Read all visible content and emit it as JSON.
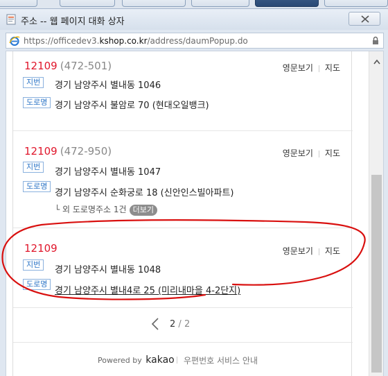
{
  "window": {
    "title": "주소 -- 웹 페이지 대화 상자",
    "url_prefix": "https://officedev3.",
    "url_domain": "kshop.co.kr",
    "url_path": "/address/daumPopup.do"
  },
  "results": [
    {
      "zipcode": "12109",
      "old_zipcode": "(472-501)",
      "english_link": "영문보기",
      "map_link": "지도",
      "jibun_badge": "지번",
      "jibun_address": "경기 남양주시 별내동 1046",
      "road_badge": "도로명",
      "road_address": "경기 남양주시 불암로 70 (현대오일뱅크)"
    },
    {
      "zipcode": "12109",
      "old_zipcode": "(472-950)",
      "english_link": "영문보기",
      "map_link": "지도",
      "jibun_badge": "지번",
      "jibun_address": "경기 남양주시 별내동 1047",
      "road_badge": "도로명",
      "road_address": "경기 남양주시 순화궁로 18 (신안인스빌아파트)",
      "more_text": "└ 외 도로명주소 1건",
      "more_button": "더보기"
    },
    {
      "zipcode": "12109",
      "english_link": "영문보기",
      "map_link": "지도",
      "jibun_badge": "지번",
      "jibun_address": "경기 남양주시 별내동 1048",
      "road_badge": "도로명",
      "road_address": "경기 남양주시 별내4로 25 (미리내마을 4-2단지)"
    }
  ],
  "pager": {
    "current": "2",
    "separator": "/",
    "total": "2"
  },
  "footer": {
    "powered_by": "Powered by",
    "brand": "kakao",
    "service_guide": "우편번호 서비스 안내"
  },
  "colors": {
    "zipcode": "#e0162b",
    "badge": "#2e76c7",
    "annotation": "#d9100f"
  }
}
